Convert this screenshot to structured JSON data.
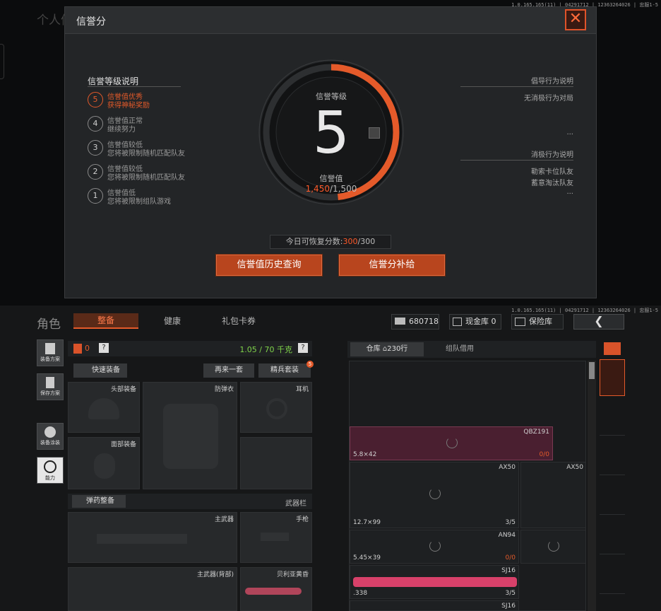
{
  "version": "1.0.165.165(11) | 04291712 | 12363264026 | 忠服1-5",
  "bg_title": "个人信",
  "modal": {
    "title": "信誉分",
    "left_title": "信誉等级说明",
    "levels": [
      {
        "num": "5",
        "l1": "信誉值优秀",
        "l2": "获得神秘奖励",
        "active": true
      },
      {
        "num": "4",
        "l1": "信誉值正常",
        "l2": "继续努力",
        "active": false
      },
      {
        "num": "3",
        "l1": "信誉值较低",
        "l2": "您将被限制随机匹配队友",
        "active": false
      },
      {
        "num": "2",
        "l1": "信誉值较低",
        "l2": "您将被限制随机匹配队友",
        "active": false
      },
      {
        "num": "1",
        "l1": "信誉值低",
        "l2": "您将被限制组队游戏",
        "active": false
      }
    ],
    "gauge": {
      "label": "信誉等级",
      "level": "5",
      "value_label": "信誉值",
      "value": "1,450",
      "max": "/1,500",
      "fraction": 0.9667
    },
    "right1_title": "倡导行为说明",
    "right1_items": [
      "无消极行为对局",
      "..."
    ],
    "right2_title": "消极行为说明",
    "right2_items": [
      "勒索卡位队友",
      "蓄意淘汰队友",
      "..."
    ],
    "recover_label": "今日可恢复分数:",
    "recover_value": "300",
    "recover_max": "/300",
    "btn_history": "信誉值历史查询",
    "btn_supplement": "信誉分补给",
    "colors": {
      "accent": "#e45a2a"
    }
  },
  "topbar": {
    "title": "角色",
    "tabs": [
      "整备",
      "健康",
      "礼包卡券"
    ],
    "money": "680718",
    "cash_label": "现金库 0",
    "safe_label": "保险库"
  },
  "sidebar": [
    "装备方案",
    "保存方案",
    "装备涂装",
    "能力"
  ],
  "loadout": {
    "bag_count": "0",
    "weight": "1.05 / 70 千克",
    "quick_equip": "快速装备",
    "again": "再来一套",
    "elite": "精兵套装",
    "elite_badge": "5",
    "slots": {
      "head": "头部装备",
      "armor": "防弹衣",
      "ear": "耳机",
      "face": "面部装备"
    },
    "ammo_equip": "弹药整备",
    "weapon_bar": "武器栏",
    "primary": "主武器",
    "pistol": "手枪",
    "primary_back": "主武器(背部)",
    "melee": "贝利亚黄昏"
  },
  "storage": {
    "tab_warehouse": "仓库",
    "rows": "230行",
    "tab_team": "组队借用",
    "items": [
      {
        "name": "QBZ191",
        "caliber": "5.8×42",
        "count": "0/0"
      },
      {
        "name": "AX50",
        "caliber": "12.7×99",
        "count": "3/5"
      },
      {
        "name": "AX50",
        "caliber": "",
        "count": ""
      },
      {
        "name": "AN94",
        "caliber": "5.45×39",
        "count": "0/0"
      },
      {
        "name": "SJ16",
        "caliber": ".338",
        "count": "3/5"
      },
      {
        "name": "SJ16",
        "caliber": "",
        "count": ""
      }
    ]
  }
}
